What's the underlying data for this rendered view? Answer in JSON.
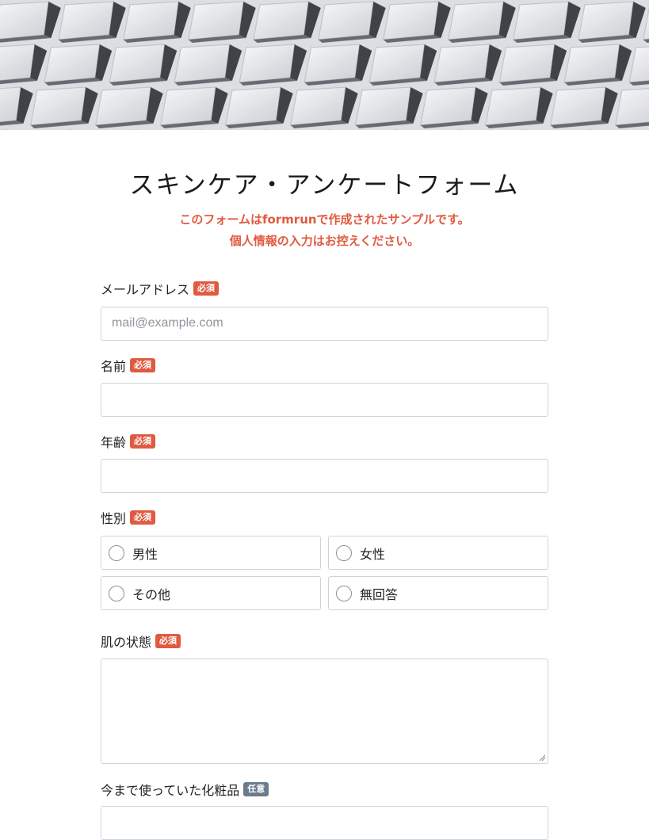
{
  "form": {
    "title": "スキンケア・アンケートフォーム",
    "notice_line1": "このフォームはformrunで作成されたサンプルです。",
    "notice_line2": "個人情報の入力はお控えください。",
    "required_badge": "必須",
    "optional_badge": "任意",
    "email_label": "メールアドレス",
    "email_placeholder": "mail@example.com",
    "name_label": "名前",
    "age_label": "年齢",
    "gender_label": "性別",
    "gender_options": [
      "男性",
      "女性",
      "その他",
      "無回答"
    ],
    "skin_label": "肌の状態",
    "cosmetics_label": "今まで使っていた化粧品"
  }
}
